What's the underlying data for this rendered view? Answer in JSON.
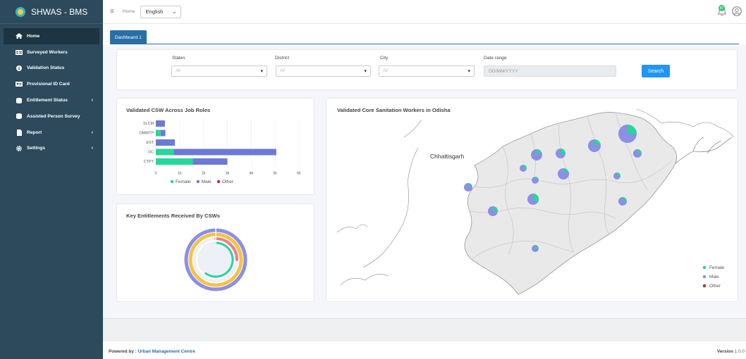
{
  "app": {
    "title": "SHWAS - BMS"
  },
  "sidebar": {
    "items": [
      {
        "label": "Home",
        "icon": "home-icon"
      },
      {
        "label": "Surveyed Workers",
        "icon": "table-icon"
      },
      {
        "label": "Validation Status",
        "icon": "info-icon"
      },
      {
        "label": "Provisional ID Card",
        "icon": "id-card-icon"
      },
      {
        "label": "Entitlement Status",
        "icon": "database-icon"
      },
      {
        "label": "Assisted Person Survey",
        "icon": "database-icon"
      },
      {
        "label": "Report",
        "icon": "file-icon"
      },
      {
        "label": "Settings",
        "icon": "gear-icon"
      }
    ]
  },
  "topbar": {
    "home": "Home",
    "language": "English",
    "notification_count": "47"
  },
  "tabs": {
    "dashboard": "Dashboard 1"
  },
  "filters": {
    "states_label": "States",
    "states_value": "All",
    "district_label": "District",
    "district_value": "All",
    "city_label": "City",
    "city_value": "All",
    "date_label": "Date range",
    "date_placeholder": "DD/MM/YYYY",
    "search": "Search"
  },
  "job_roles_card": {
    "title": "Validated CSW Across Job Roles"
  },
  "entitlements_card": {
    "title": "Key Entitlements Received By CSWs"
  },
  "map_card": {
    "title": "Validated Core Sanitation Workers in Odisha",
    "neighbor_label": "Chhattisgarh"
  },
  "chart_data": [
    {
      "type": "bar",
      "orientation": "horizontal",
      "stacked": true,
      "categories": [
        "SLCM",
        "OMWTP",
        "EST",
        "DC",
        "CTPT"
      ],
      "series": [
        {
          "name": "Female",
          "color": "#26d69a",
          "values": [
            0,
            200,
            0,
            750,
            1550
          ]
        },
        {
          "name": "Male",
          "color": "#6c79d6",
          "values": [
            380,
            200,
            800,
            4300,
            1450
          ]
        },
        {
          "name": "Other",
          "color": "#b83238",
          "values": [
            0,
            0,
            0,
            0,
            0
          ]
        }
      ],
      "xticks": [
        "0",
        "1k",
        "2k",
        "3k",
        "4k",
        "5k",
        "6k"
      ],
      "xlim": [
        0,
        6000
      ],
      "legend": "bottom"
    },
    {
      "type": "pie",
      "variant": "radial-rings",
      "series": [
        {
          "color": "#8c8fe6",
          "value": 100
        },
        {
          "color": "#f7c243",
          "value": 100
        },
        {
          "color": "#f07c86",
          "value": 25
        },
        {
          "color": "#26d69a",
          "value": 60
        }
      ]
    }
  ],
  "map_legend": [
    {
      "label": "Female",
      "color": "#26d69a"
    },
    {
      "label": "Male",
      "color": "#8c8fe6"
    },
    {
      "label": "Other",
      "color": "#b83238"
    }
  ],
  "map_pies": [
    {
      "female": 0.25
    },
    {
      "female": 0.2
    },
    {
      "female": 0.3
    },
    {
      "female": 0.15
    },
    {
      "female": 0.2
    },
    {
      "female": 0.25
    },
    {
      "female": 0.15
    },
    {
      "female": 0.2
    },
    {
      "female": 0.3
    },
    {
      "female": 0.35
    },
    {
      "female": 0.25
    },
    {
      "female": 0.2
    },
    {
      "female": 0.15
    },
    {
      "female": 0.25
    },
    {
      "female": 0.1
    }
  ],
  "footer": {
    "powered_prefix": "Powered by : ",
    "org": "Urban Management Centre",
    "version_label": "Version",
    "version": "1.0.0"
  }
}
